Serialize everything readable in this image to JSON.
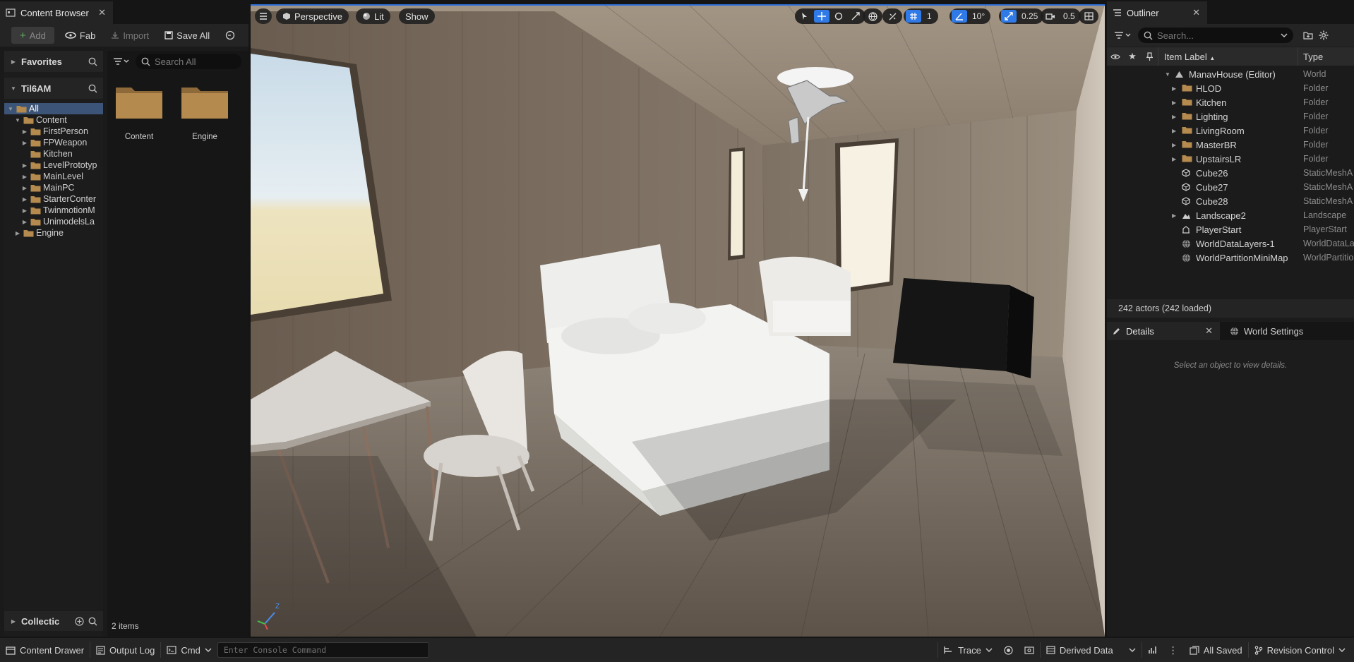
{
  "content_browser": {
    "tab_title": "Content Browser",
    "toolbar": {
      "add": "Add",
      "fab": "Fab",
      "import": "Import",
      "save_all": "Save All"
    },
    "favorites_label": "Favorites",
    "project_label": "Til6AM",
    "tree": [
      {
        "label": "All",
        "depth": 0,
        "caret": "down",
        "selected": true
      },
      {
        "label": "Content",
        "depth": 1,
        "caret": "down"
      },
      {
        "label": "FirstPerson",
        "depth": 2,
        "caret": "right"
      },
      {
        "label": "FPWeapon",
        "depth": 2,
        "caret": "right"
      },
      {
        "label": "Kitchen",
        "depth": 2,
        "caret": "none"
      },
      {
        "label": "LevelPrototyp",
        "depth": 2,
        "caret": "right"
      },
      {
        "label": "MainLevel",
        "depth": 2,
        "caret": "right"
      },
      {
        "label": "MainPC",
        "depth": 2,
        "caret": "right"
      },
      {
        "label": "StarterConter",
        "depth": 2,
        "caret": "right"
      },
      {
        "label": "TwinmotionM",
        "depth": 2,
        "caret": "right"
      },
      {
        "label": "UnimodelsLa",
        "depth": 2,
        "caret": "right"
      },
      {
        "label": "Engine",
        "depth": 1,
        "caret": "right"
      }
    ],
    "search_placeholder": "Search All",
    "assets": [
      {
        "label": "Content"
      },
      {
        "label": "Engine"
      }
    ],
    "item_count": "2 items",
    "collections_label": "Collectic"
  },
  "viewport": {
    "perspective_label": "Perspective",
    "lit_label": "Lit",
    "show_label": "Show",
    "grid_value": "1",
    "angle_value": "10°",
    "scale_value": "0.25",
    "camera_speed": "0.5",
    "axis_labels": {
      "z": "Z"
    }
  },
  "outliner": {
    "tab_title": "Outliner",
    "search_placeholder": "Search...",
    "col_label": "Item Label",
    "col_type": "Type",
    "rows": [
      {
        "label": "ManavHouse (Editor)",
        "type": "World",
        "depth": 0,
        "caret": "down",
        "icon": "world"
      },
      {
        "label": "HLOD",
        "type": "Folder",
        "depth": 1,
        "caret": "right",
        "icon": "folder"
      },
      {
        "label": "Kitchen",
        "type": "Folder",
        "depth": 1,
        "caret": "right",
        "icon": "folder"
      },
      {
        "label": "Lighting",
        "type": "Folder",
        "depth": 1,
        "caret": "right",
        "icon": "folder"
      },
      {
        "label": "LivingRoom",
        "type": "Folder",
        "depth": 1,
        "caret": "right",
        "icon": "folder"
      },
      {
        "label": "MasterBR",
        "type": "Folder",
        "depth": 1,
        "caret": "right",
        "icon": "folder"
      },
      {
        "label": "UpstairsLR",
        "type": "Folder",
        "depth": 1,
        "caret": "right",
        "icon": "folder"
      },
      {
        "label": "Cube26",
        "type": "StaticMeshA",
        "depth": 1,
        "caret": "none",
        "icon": "mesh"
      },
      {
        "label": "Cube27",
        "type": "StaticMeshA",
        "depth": 1,
        "caret": "none",
        "icon": "mesh"
      },
      {
        "label": "Cube28",
        "type": "StaticMeshA",
        "depth": 1,
        "caret": "none",
        "icon": "mesh"
      },
      {
        "label": "Landscape2",
        "type": "Landscape",
        "depth": 1,
        "caret": "right",
        "icon": "landscape"
      },
      {
        "label": "PlayerStart",
        "type": "PlayerStart",
        "depth": 1,
        "caret": "none",
        "icon": "player"
      },
      {
        "label": "WorldDataLayers-1",
        "type": "WorldDataLa",
        "depth": 1,
        "caret": "none",
        "icon": "globe"
      },
      {
        "label": "WorldPartitionMiniMap",
        "type": "WorldPartitio",
        "depth": 1,
        "caret": "none",
        "icon": "globe"
      }
    ],
    "actor_count": "242 actors (242 loaded)"
  },
  "details": {
    "tab_details": "Details",
    "tab_world_settings": "World Settings",
    "empty_message": "Select an object to view details."
  },
  "statusbar": {
    "content_drawer": "Content Drawer",
    "output_log": "Output Log",
    "cmd": "Cmd",
    "console_placeholder": "Enter Console Command",
    "trace": "Trace",
    "derived_data": "Derived Data",
    "all_saved": "All Saved",
    "revision_control": "Revision Control"
  },
  "colors": {
    "accent": "#2f7ae6",
    "folder": "#b48a4e",
    "selection": "#3c5478"
  }
}
